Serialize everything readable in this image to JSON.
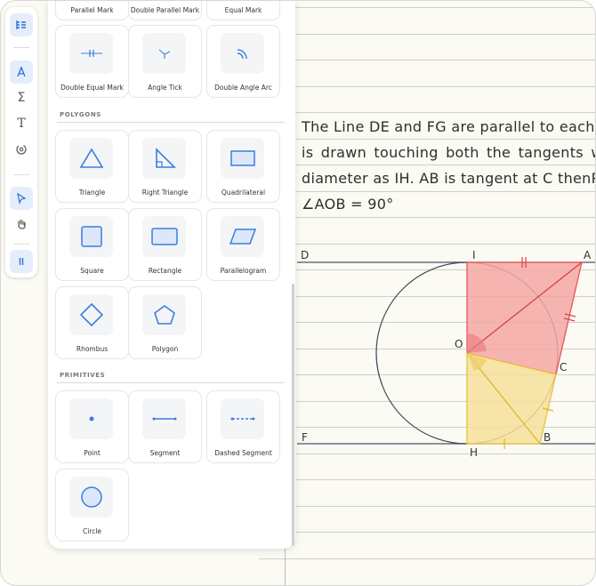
{
  "toolbar": {
    "items": [
      {
        "icon": "panel-toggle-icon",
        "active": true
      },
      {
        "icon": "compass-icon",
        "active": true
      },
      {
        "icon": "sigma-icon",
        "active": false
      },
      {
        "icon": "text-icon",
        "active": false
      },
      {
        "icon": "rotate-shape-icon",
        "active": false
      },
      {
        "icon": "pointer-icon",
        "active": true
      },
      {
        "icon": "hand-icon",
        "active": false
      },
      {
        "icon": "parallel-mark-icon",
        "active": true
      }
    ]
  },
  "panel": {
    "top_row_partial": [
      "Parallel Mark",
      "Double Parallel Mark",
      "Equal Mark"
    ],
    "marks": [
      "Double Equal Mark",
      "Angle Tick",
      "Double Angle Arc"
    ],
    "polygons_title": "POLYGONS",
    "polygons": [
      "Triangle",
      "Right Triangle",
      "Quadrilateral",
      "Square",
      "Rectangle",
      "Parallelogram",
      "Rhombus",
      "Polygon"
    ],
    "primitives_title": "PRIMITIVES",
    "primitives": [
      "Point",
      "Segment",
      "Dashed Segment",
      "Circle"
    ]
  },
  "notes": {
    "lines": [
      "The Line DE and FG are parallel to each othe",
      "is  drawn  touching  both  the  tangents  w",
      "diameter as IH. AB is tangent at C thenP",
      "∠AOB = 90°"
    ]
  },
  "figure": {
    "labels": {
      "D": "D",
      "I": "I",
      "A": "A",
      "O": "O",
      "C": "C",
      "F": "F",
      "H": "H",
      "B": "B"
    },
    "colors": {
      "red_fill": "#f4a7a3",
      "red_stroke": "#e8555a",
      "yellow_fill": "#f6df9a",
      "yellow_stroke": "#e9c23a",
      "circle": "#3f4a5a",
      "accent": "#3b7de0"
    }
  }
}
